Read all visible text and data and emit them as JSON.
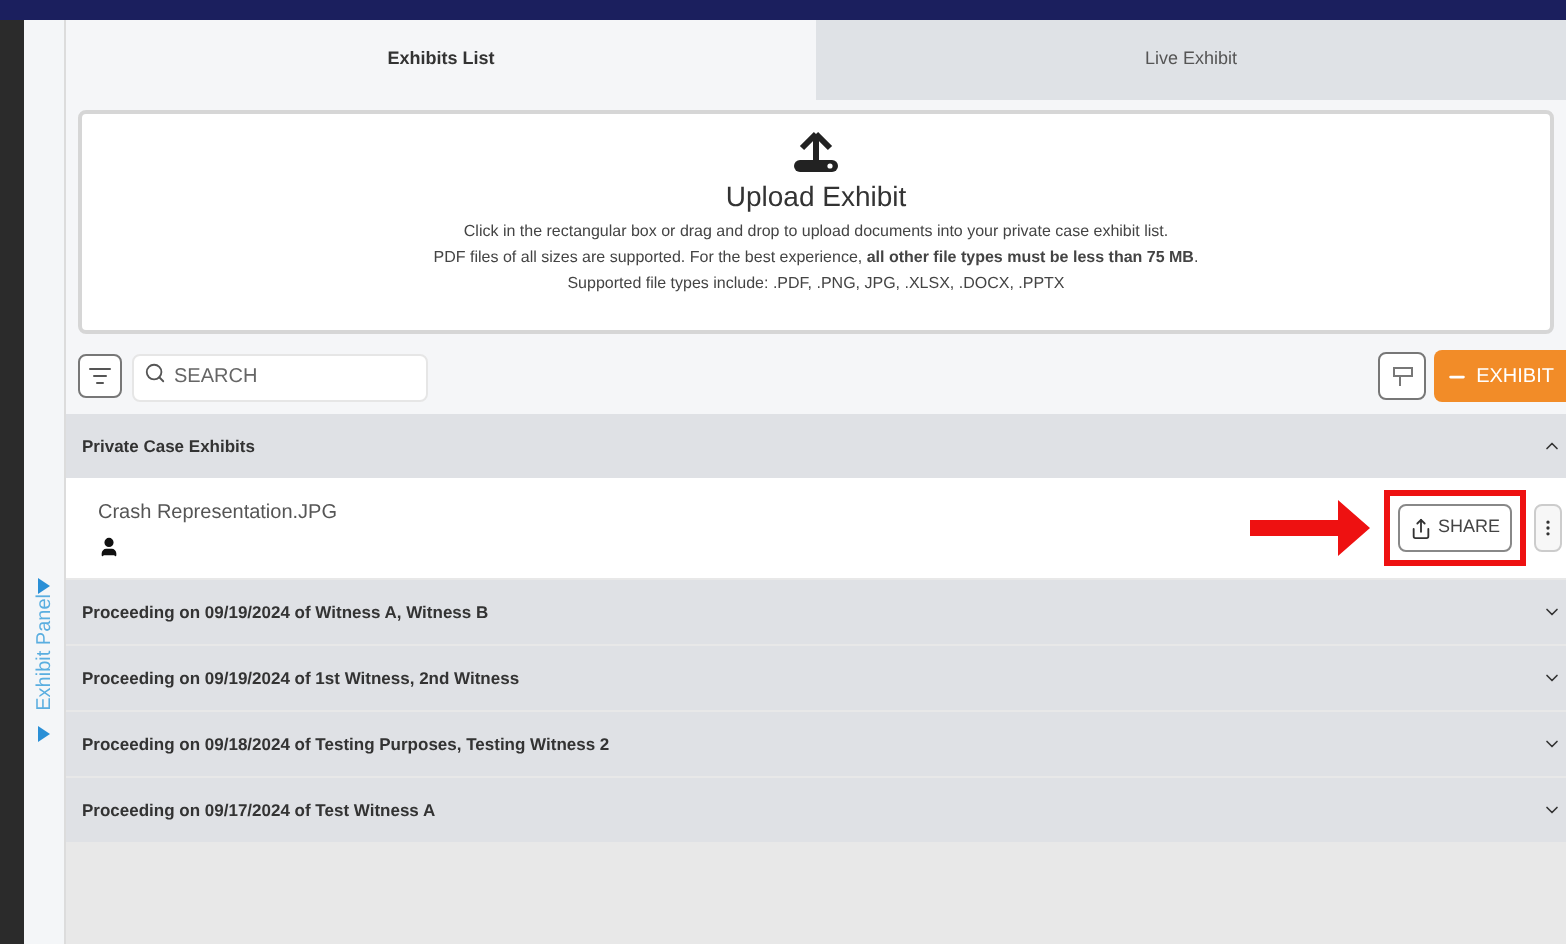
{
  "side_panel": {
    "label": "Exhibit Panel"
  },
  "tabs": [
    {
      "label": "Exhibits List",
      "selected": true
    },
    {
      "label": "Live Exhibit",
      "selected": false
    }
  ],
  "upload": {
    "title": "Upload Exhibit",
    "lines": [
      "Click in the rectangular box or drag and drop to upload documents into your private case exhibit list.",
      "PDF files of all sizes are supported. For the best experience, **all other file types must be less than 75 MB**.",
      "Supported file types include: .PDF, .PNG, JPG, .XLSX, .DOCX, .PPTX"
    ]
  },
  "toolbar": {
    "search": {
      "placeholder": "SEARCH"
    },
    "add_button": "EXHIBIT"
  },
  "groups": [
    {
      "title": "Private Case Exhibits",
      "expanded": true,
      "items": [
        {
          "name": "Crash Representation.JPG",
          "share_label": "SHARE",
          "highlighted": true
        }
      ]
    },
    {
      "title": "Proceeding on 09/19/2024 of Witness A, Witness B",
      "expanded": false
    },
    {
      "title": "Proceeding on 09/19/2024 of 1st Witness, 2nd Witness",
      "expanded": false
    },
    {
      "title": "Proceeding on 09/18/2024 of Testing Purposes, Testing Witness 2",
      "expanded": false
    },
    {
      "title": "Proceeding on 09/17/2024 of Test Witness A",
      "expanded": false
    }
  ]
}
